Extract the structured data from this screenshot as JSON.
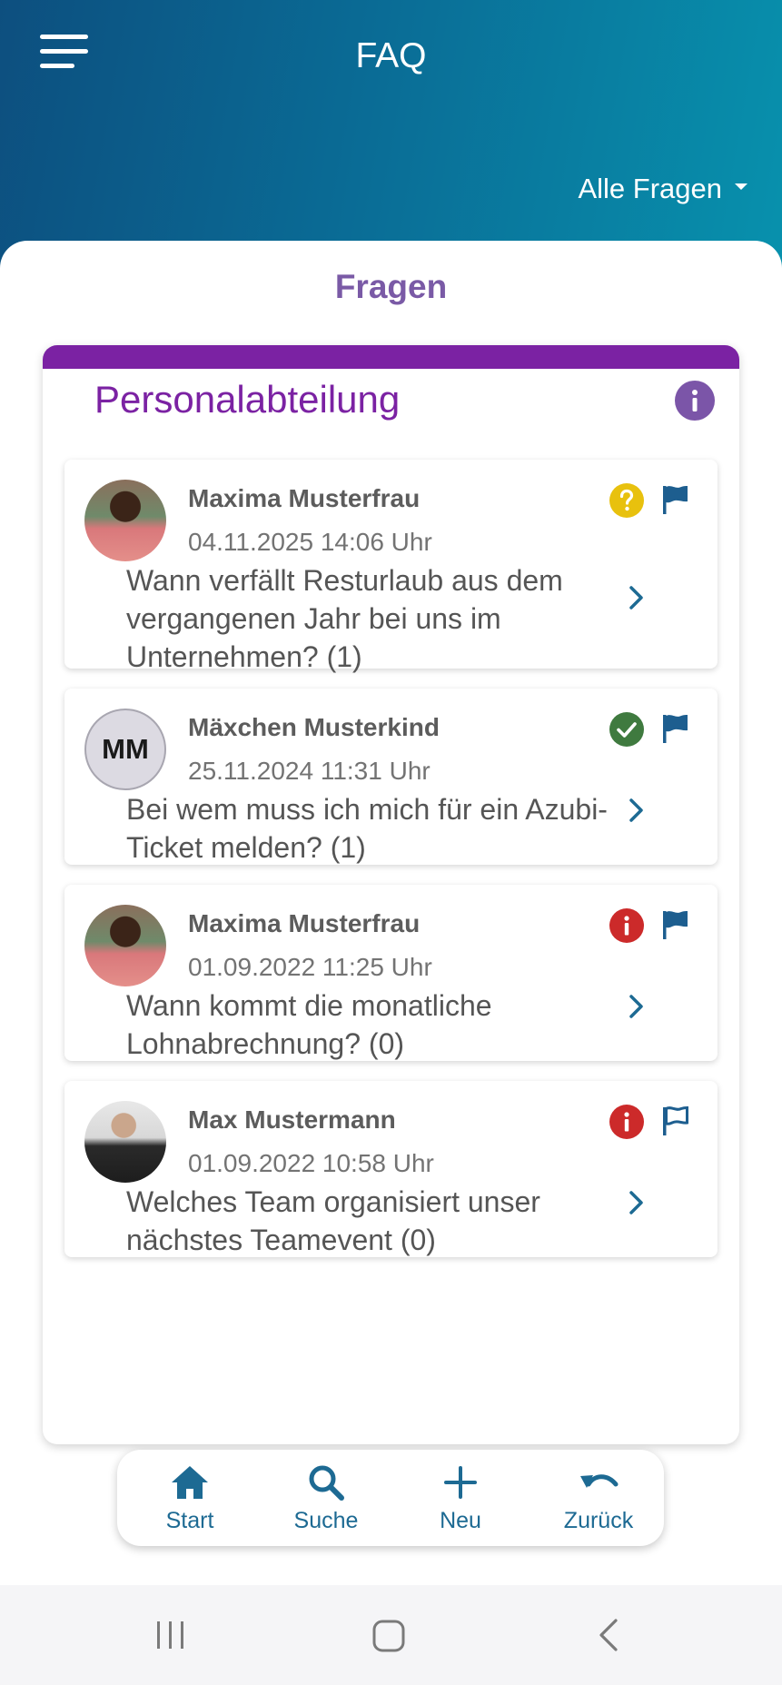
{
  "header": {
    "title": "FAQ",
    "filter_label": "Alle Fragen",
    "menu_icon": "hamburger-menu-icon",
    "background": "#0a6b95"
  },
  "main": {
    "section_title": "Fragen",
    "category": {
      "title": "Personalabteilung",
      "accent_color": "#7b22a3",
      "info_icon": "info-icon"
    },
    "questions": [
      {
        "author": "Maxima Musterfrau",
        "avatar": "photo",
        "date": "04.11.2025 14:06 Uhr",
        "status": "open",
        "status_icon": "question-icon",
        "status_color": "#e8c10e",
        "flagged": true,
        "text": "Wann verfällt Resturlaub aus dem vergangenen Jahr bei uns im Unternehmen? (1)"
      },
      {
        "author": "Mäxchen Musterkind",
        "avatar_initials": "MM",
        "date": "25.11.2024 11:31 Uhr",
        "status": "answered",
        "status_icon": "check-icon",
        "status_color": "#3f7a3f",
        "flagged": true,
        "text": "Bei wem muss ich mich für ein Azubi-Ticket melden? (1)"
      },
      {
        "author": "Maxima Musterfrau",
        "avatar": "photo",
        "date": "01.09.2022 11:25 Uhr",
        "status": "unanswered",
        "status_icon": "info-icon",
        "status_color": "#cc2a2a",
        "flagged": true,
        "text": "Wann kommt die monatliche Lohnabrechnung? (0)"
      },
      {
        "author": "Max Mustermann",
        "avatar": "photo",
        "date": "01.09.2022 10:58 Uhr",
        "status": "unanswered",
        "status_icon": "info-icon",
        "status_color": "#cc2a2a",
        "flagged": false,
        "text": "Welches Team organisiert unser nächstes Teamevent (0)"
      }
    ]
  },
  "bottom_nav": {
    "items": [
      {
        "label": "Start",
        "icon": "home-icon"
      },
      {
        "label": "Suche",
        "icon": "search-icon"
      },
      {
        "label": "Neu",
        "icon": "plus-icon"
      },
      {
        "label": "Zurück",
        "icon": "undo-icon"
      }
    ],
    "color": "#1d6a93"
  },
  "system_nav": {
    "buttons": [
      "recent-apps-icon",
      "home-circle-icon",
      "back-icon"
    ]
  }
}
